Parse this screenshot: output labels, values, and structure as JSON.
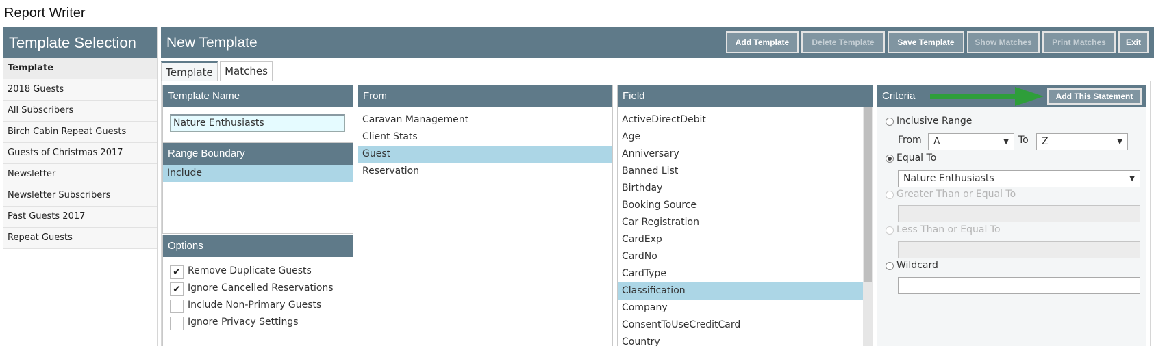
{
  "app_title": "Report Writer",
  "sidebar": {
    "header": "Template Selection",
    "items": [
      {
        "label": "Template"
      },
      {
        "label": "2018 Guests"
      },
      {
        "label": "All Subscribers"
      },
      {
        "label": "Birch Cabin Repeat Guests"
      },
      {
        "label": "Guests of Christmas 2017"
      },
      {
        "label": "Newsletter"
      },
      {
        "label": "Newsletter Subscribers"
      },
      {
        "label": "Past Guests 2017"
      },
      {
        "label": "Repeat Guests"
      }
    ]
  },
  "header": {
    "title": "New Template",
    "buttons": [
      {
        "label": "Add Template"
      },
      {
        "label": "Delete Template"
      },
      {
        "label": "Save Template"
      },
      {
        "label": "Show Matches"
      },
      {
        "label": "Print Matches"
      },
      {
        "label": "Exit"
      }
    ]
  },
  "tabs": [
    {
      "label": "Template"
    },
    {
      "label": "Matches"
    }
  ],
  "template_name": {
    "header": "Template Name",
    "value": "Nature Enthusiasts"
  },
  "range_boundary": {
    "header": "Range Boundary",
    "items": [
      {
        "label": "Include"
      }
    ]
  },
  "options": {
    "header": "Options",
    "items": [
      {
        "label": "Remove Duplicate Guests",
        "mark": "✔"
      },
      {
        "label": "Ignore Cancelled Reservations",
        "mark": "✔"
      },
      {
        "label": "Include Non-Primary Guests",
        "mark": ""
      },
      {
        "label": "Ignore Privacy Settings",
        "mark": ""
      }
    ]
  },
  "from": {
    "header": "From",
    "items": [
      {
        "label": "Caravan Management"
      },
      {
        "label": "Client Stats"
      },
      {
        "label": "Guest"
      },
      {
        "label": "Reservation"
      }
    ]
  },
  "field": {
    "header": "Field",
    "items": [
      {
        "label": "ActiveDirectDebit"
      },
      {
        "label": "Age"
      },
      {
        "label": "Anniversary"
      },
      {
        "label": "Banned List"
      },
      {
        "label": "Birthday"
      },
      {
        "label": "Booking Source"
      },
      {
        "label": "Car Registration"
      },
      {
        "label": "CardExp"
      },
      {
        "label": "CardNo"
      },
      {
        "label": "CardType"
      },
      {
        "label": "Classification"
      },
      {
        "label": "Company"
      },
      {
        "label": "ConsentToUseCreditCard"
      },
      {
        "label": "Country"
      }
    ]
  },
  "criteria": {
    "header": "Criteria",
    "add_statement": "Add This Statement",
    "inclusive_range": "Inclusive Range",
    "from_label": "From",
    "from_value": "A",
    "to_label": "To",
    "to_value": "Z",
    "equal_to": "Equal To",
    "equal_to_value": "Nature Enthusiasts",
    "greater_than": "Greater Than or Equal To",
    "less_than": "Less Than or Equal To",
    "wildcard": "Wildcard",
    "caret": "▼"
  },
  "colors": {
    "header_bg": "#5f7a89",
    "selected_row": "#acd6e6",
    "input_bg": "#e5fbff",
    "arrow": "#2e9e3a"
  }
}
